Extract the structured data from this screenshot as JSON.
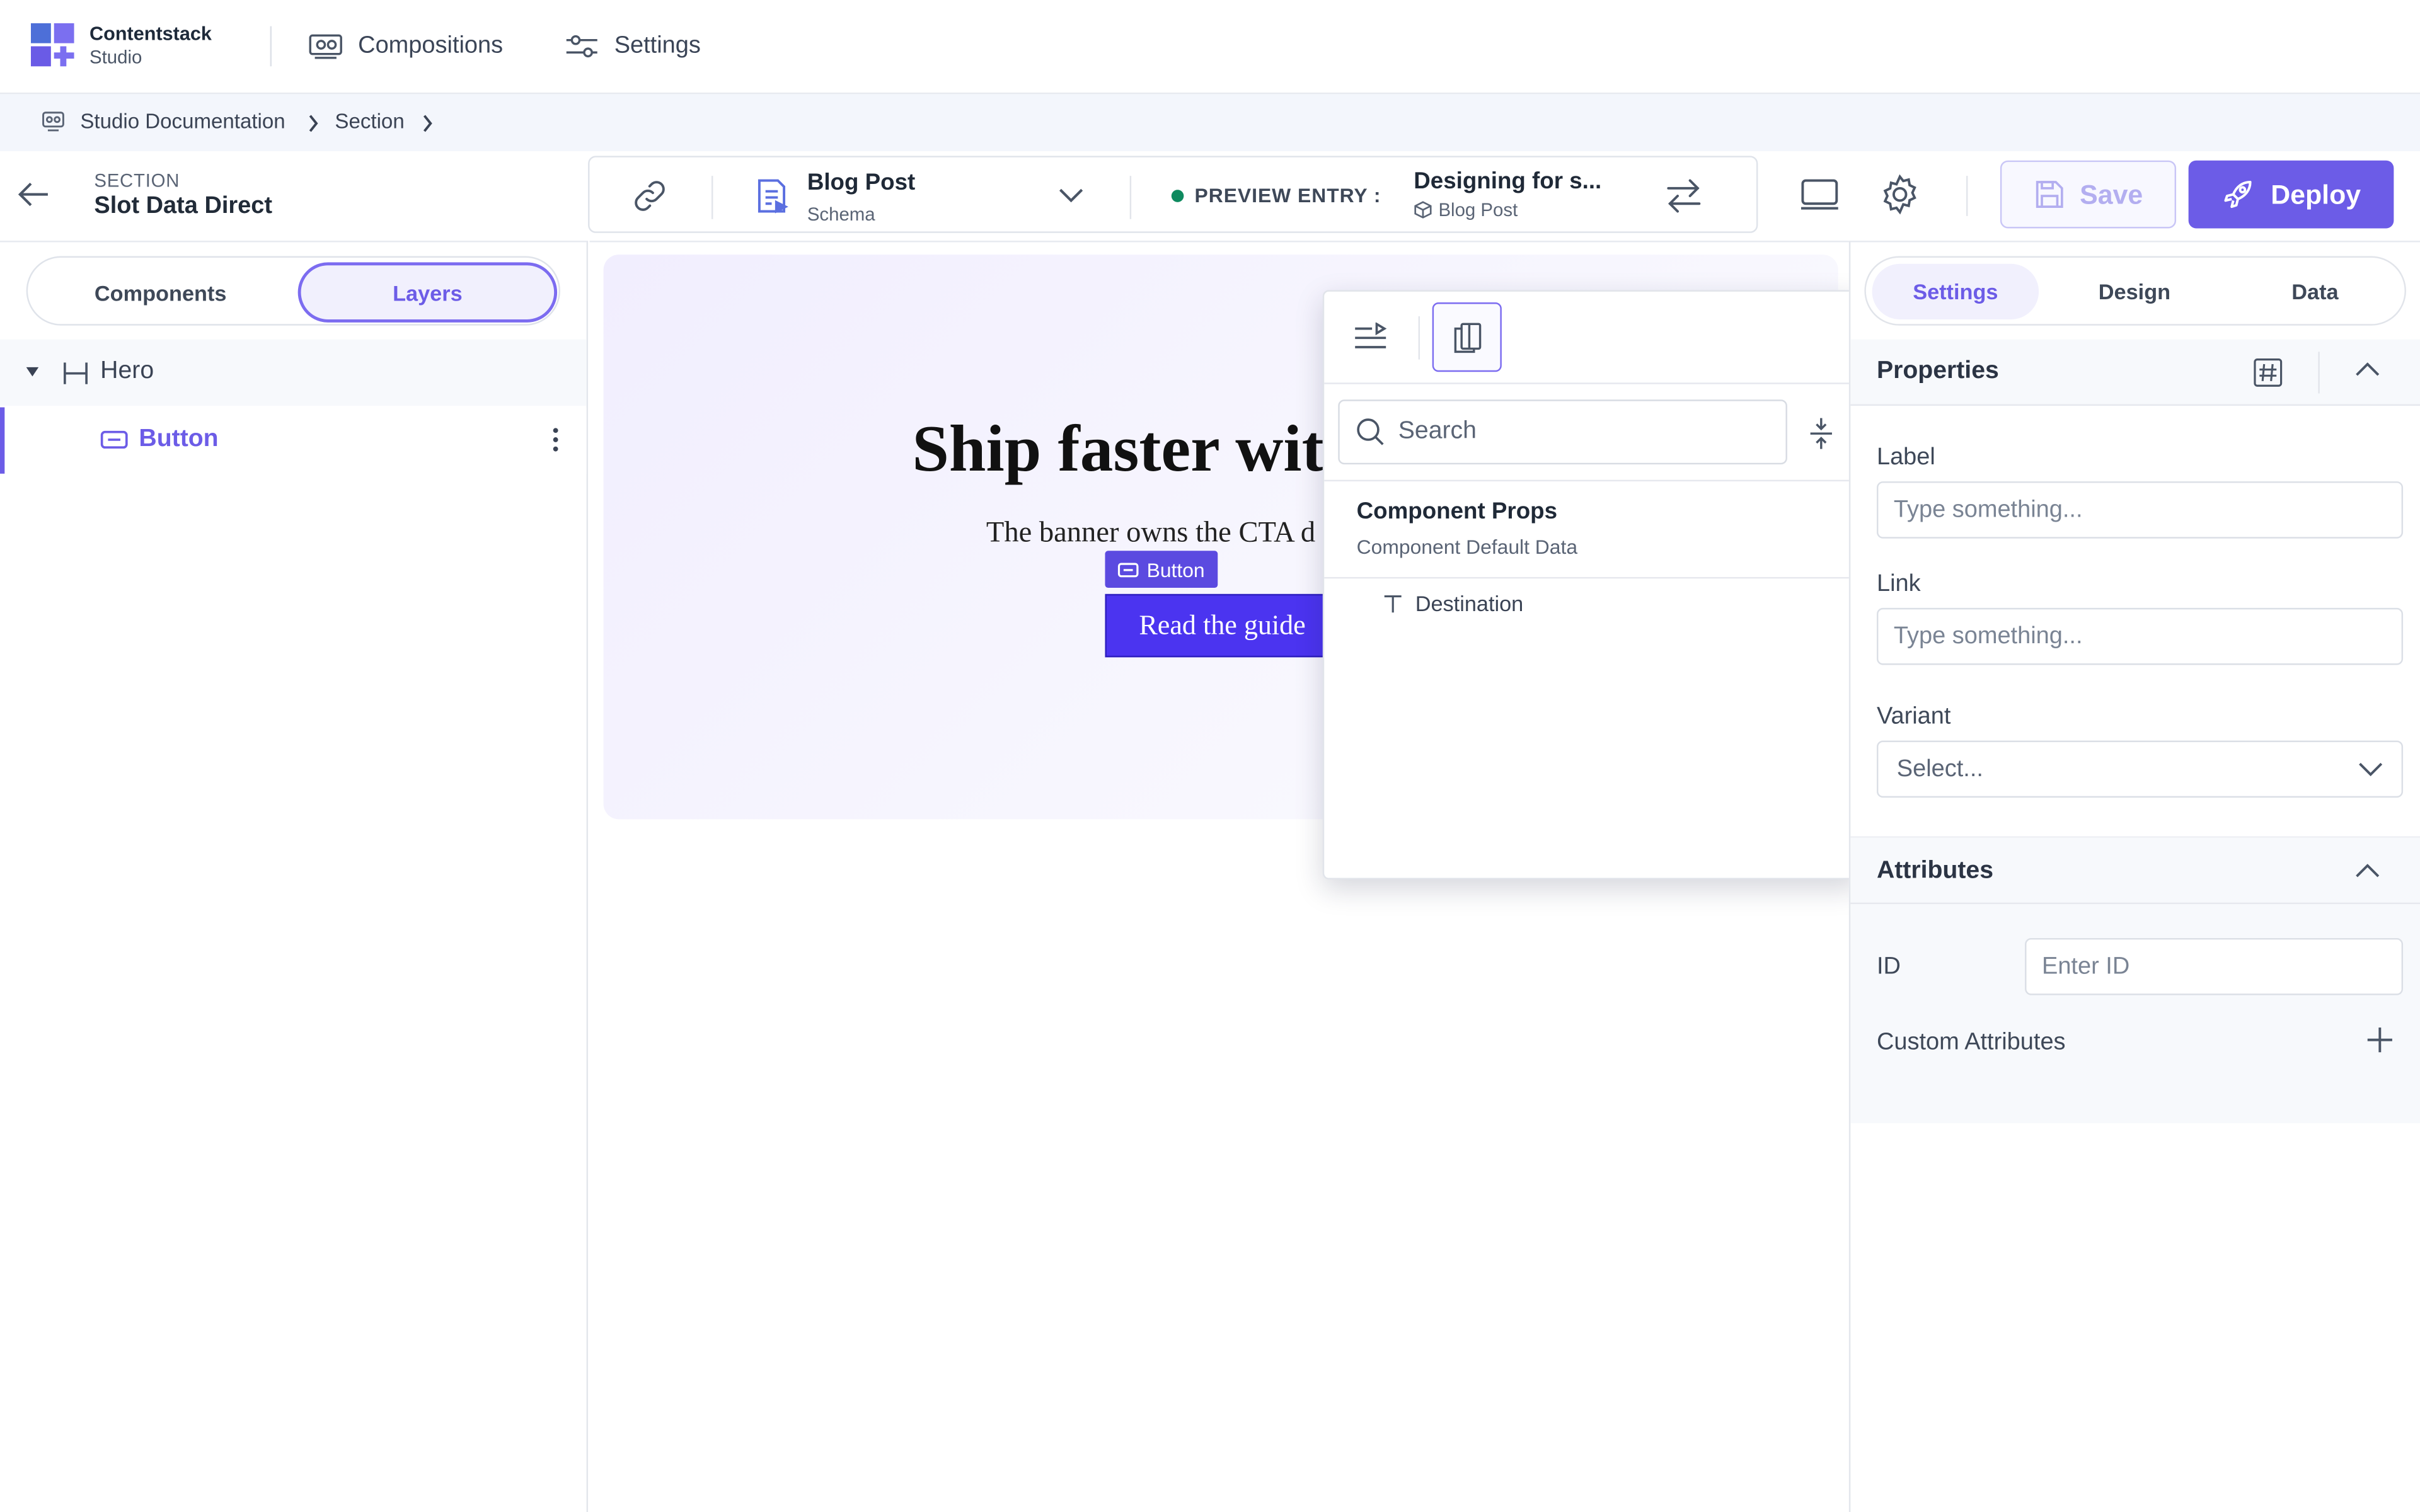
{
  "app": {
    "brand_line1": "Contentstack",
    "brand_line2": "Studio"
  },
  "topnav": {
    "compositions": "Compositions",
    "settings": "Settings"
  },
  "breadcrumb": {
    "items": [
      "Studio Documentation",
      "Section"
    ]
  },
  "header": {
    "kind_label": "SECTION",
    "title": "Slot Data Direct"
  },
  "toolbar": {
    "schema_title": "Blog Post",
    "schema_sub": "Schema",
    "preview_label": "PREVIEW ENTRY :",
    "entry_title": "Designing for s...",
    "entry_sub": "Blog Post"
  },
  "actions": {
    "save": "Save",
    "deploy": "Deploy"
  },
  "left_tabs": {
    "components": "Components",
    "layers": "Layers"
  },
  "layers": {
    "hero": "Hero",
    "button": "Button"
  },
  "canvas": {
    "hero_title": "Ship faster with",
    "hero_sub": "The banner owns the CTA d",
    "tag_label": "Button",
    "cta_label": "Read the guide"
  },
  "popup": {
    "search_placeholder": "Search",
    "section_title": "Component Props",
    "section_sub": "Component Default Data",
    "item": "Destination"
  },
  "right_tabs": {
    "settings": "Settings",
    "design": "Design",
    "data": "Data"
  },
  "properties": {
    "title": "Properties",
    "label_label": "Label",
    "label_placeholder": "Type something...",
    "link_label": "Link",
    "link_placeholder": "Type something...",
    "variant_label": "Variant",
    "variant_value": "Select..."
  },
  "attributes": {
    "title": "Attributes",
    "id_label": "ID",
    "id_placeholder": "Enter ID",
    "custom_label": "Custom Attributes"
  },
  "colors": {
    "accent": "#6c5ce7",
    "cta": "#4b34f0",
    "live_dot": "#0e8a5f"
  }
}
